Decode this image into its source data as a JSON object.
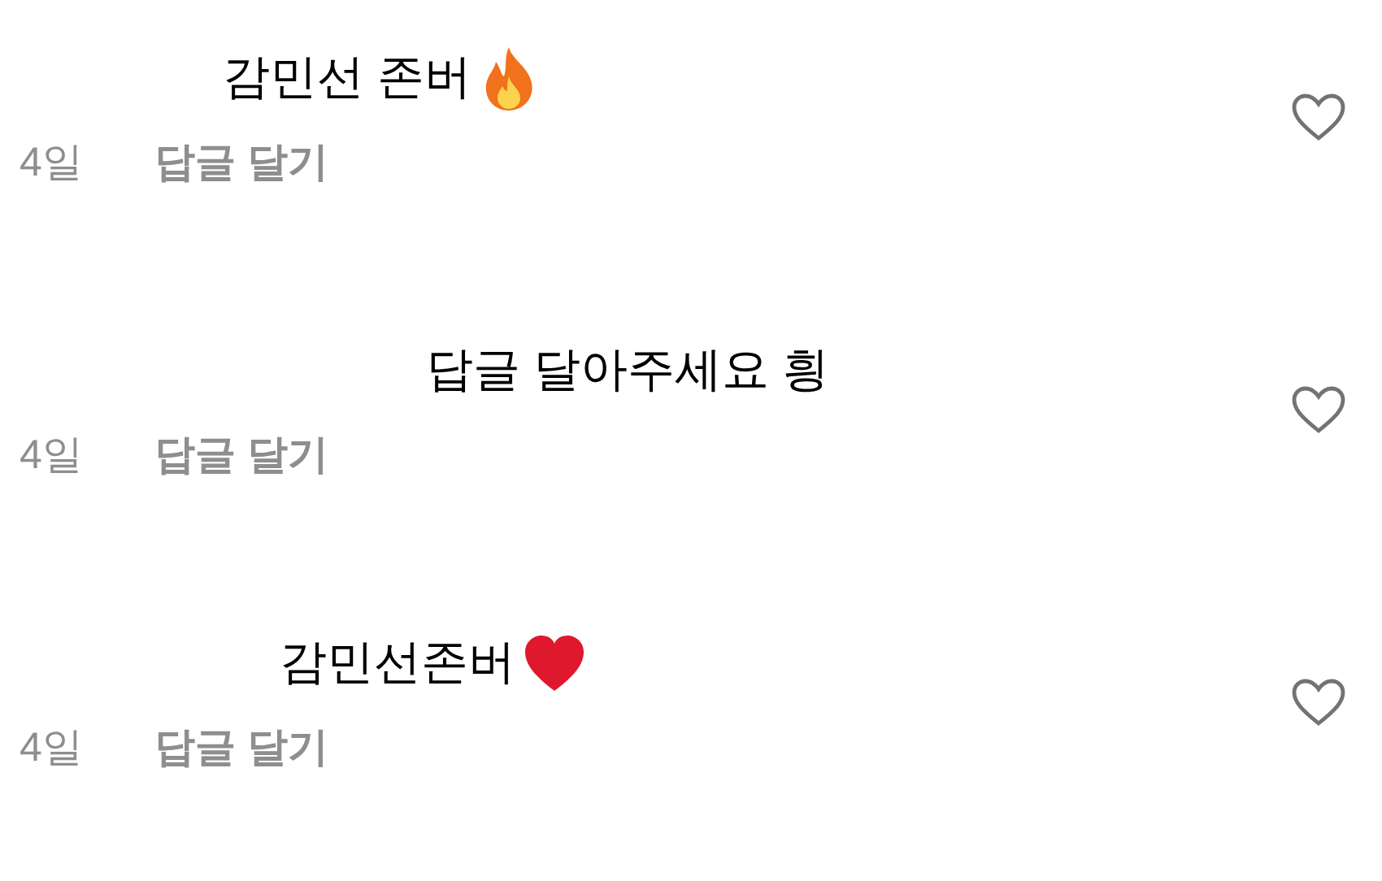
{
  "comments": [
    {
      "text": "감민선 존버",
      "kind": "fire",
      "time": "4일",
      "reply": "답글 달기",
      "liked": false
    },
    {
      "text": "답글 달아주세요 힁",
      "time": "4일",
      "reply": "답글 달기",
      "liked": false
    },
    {
      "text": "감민선존버",
      "kind": "heart",
      "time": "4일",
      "reply": "답글 달기",
      "liked": false
    }
  ]
}
